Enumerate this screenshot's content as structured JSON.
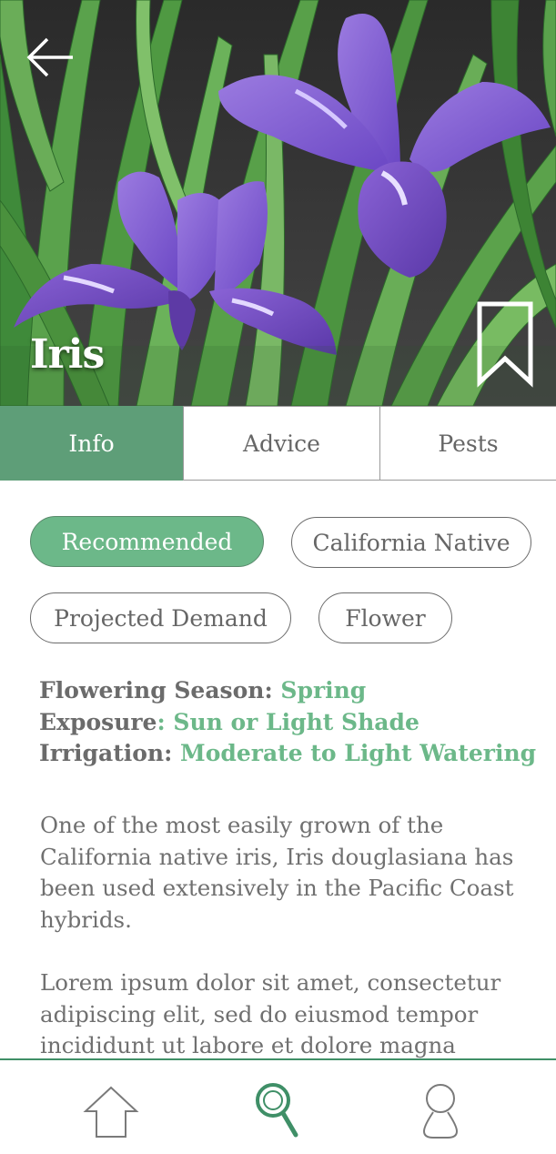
{
  "header": {
    "back_icon": "arrow-left-icon",
    "title": "Iris",
    "bookmark_icon": "bookmark-icon"
  },
  "tabs": [
    {
      "label": "Info",
      "active": true
    },
    {
      "label": "Advice",
      "active": false
    },
    {
      "label": "Pests",
      "active": false
    }
  ],
  "tags": [
    {
      "label": "Recommended",
      "active": true
    },
    {
      "label": "California Native",
      "active": false
    },
    {
      "label": "Projected Demand",
      "active": false
    },
    {
      "label": "Flower",
      "active": false
    }
  ],
  "attributes": [
    {
      "label": "Flowering Season:",
      "value": " Spring"
    },
    {
      "label": "Exposure",
      "value": ": Sun or Light Shade"
    },
    {
      "label": "Irrigation:",
      "value": " Moderate to Light Watering"
    }
  ],
  "description": [
    "One of the most easily grown of the California native iris, Iris douglasiana has been used extensively in the Pacific Coast hybrids.",
    "Lorem ipsum dolor sit amet, consectetur adipiscing elit, sed do eiusmod tempor incididunt ut labore et dolore magna"
  ],
  "bottom_nav": [
    {
      "icon": "home-icon",
      "active": false
    },
    {
      "icon": "search-icon",
      "active": true
    },
    {
      "icon": "user-icon",
      "active": false
    }
  ],
  "colors": {
    "accent": "#5e9e78",
    "accent_light": "#6cb889",
    "text": "#6b6b6b",
    "nav_active": "#3f8f67"
  }
}
